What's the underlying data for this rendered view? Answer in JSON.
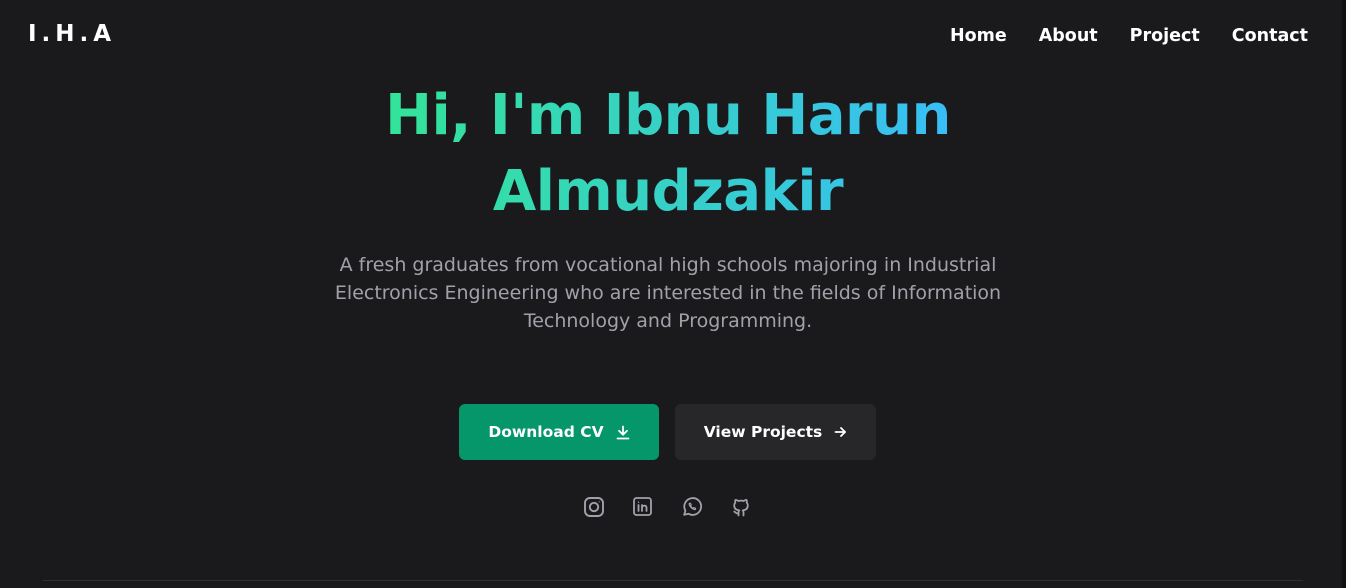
{
  "header": {
    "logo": "I.H.A",
    "nav": [
      "Home",
      "About",
      "Project",
      "Contact"
    ]
  },
  "hero": {
    "title_line1": "Hi, I'm Ibnu Harun",
    "title_line2": "Almudzakir",
    "description": "A fresh graduates from vocational high schools majoring in Industrial Electronics Engineering who are interested in the fields of Information Technology and Programming.",
    "buttons": {
      "download_label": "Download CV",
      "projects_label": "View Projects"
    }
  },
  "social": [
    "instagram-icon",
    "linkedin-icon",
    "whatsapp-icon",
    "github-icon"
  ],
  "colors": {
    "background": "#1a1a1d",
    "gradient_start": "#34e39a",
    "gradient_end": "#38bdf8",
    "primary_button": "#059669",
    "secondary_button": "#27272a",
    "muted_text": "#a1a1aa"
  }
}
